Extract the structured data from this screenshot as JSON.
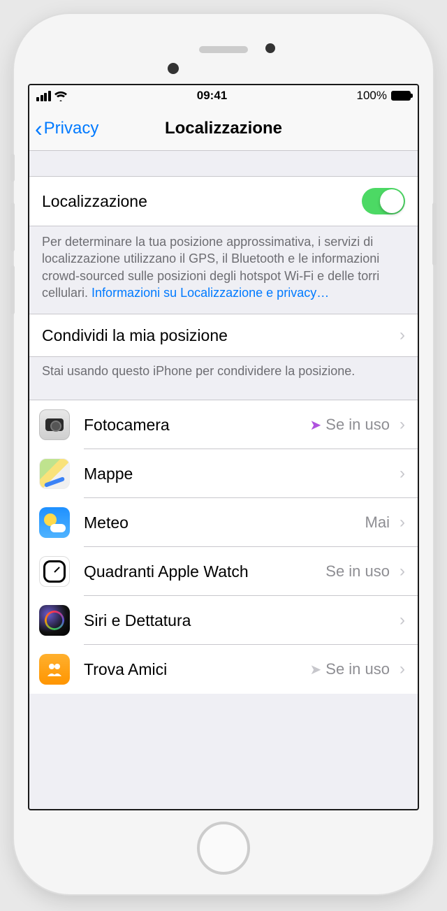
{
  "status_bar": {
    "time": "09:41",
    "battery_pct": "100%"
  },
  "nav": {
    "back_label": "Privacy",
    "title": "Localizzazione"
  },
  "main_toggle": {
    "label": "Localizzazione",
    "on": true
  },
  "description": {
    "text": "Per determinare la tua posizione approssimativa, i servizi di localizzazione utilizzano il GPS, il Bluetooth e le informazioni crowd-sourced sulle posizioni degli hotspot Wi-Fi e delle torri cellulari.",
    "link": "Informazioni su Localizzazione e privacy…"
  },
  "share_location": {
    "label": "Condividi la mia posizione",
    "footer": "Stai usando questo iPhone per condividere la posizione."
  },
  "apps": [
    {
      "name": "Fotocamera",
      "status": "Se in uso",
      "arrow": "purple",
      "icon": "camera"
    },
    {
      "name": "Mappe",
      "status": "",
      "arrow": "",
      "icon": "maps"
    },
    {
      "name": "Meteo",
      "status": "Mai",
      "arrow": "",
      "icon": "weather"
    },
    {
      "name": "Quadranti Apple Watch",
      "status": "Se in uso",
      "arrow": "",
      "icon": "watch"
    },
    {
      "name": "Siri e Dettatura",
      "status": "",
      "arrow": "",
      "icon": "siri"
    },
    {
      "name": "Trova Amici",
      "status": "Se in uso",
      "arrow": "grey",
      "icon": "friends"
    }
  ]
}
